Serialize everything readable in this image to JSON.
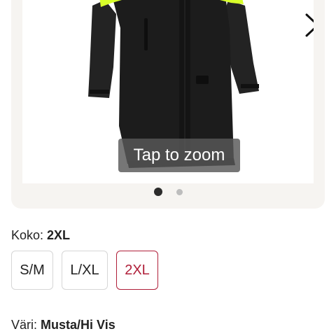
{
  "gallery": {
    "zoom_hint": "Tap to zoom",
    "image_alt": "Black rain coat with hi-vis yellow shoulders",
    "colors": {
      "coat": "#1f1f1f",
      "hivis": "#d8ff2a",
      "selected": "#b0203a"
    },
    "active_slide": 1,
    "slide_count": 2
  },
  "size": {
    "label": "Koko:",
    "selected_value": "2XL",
    "options": [
      "S/M",
      "L/XL",
      "2XL"
    ]
  },
  "color": {
    "label": "Väri:",
    "selected_value": "Musta/Hi Vis"
  }
}
